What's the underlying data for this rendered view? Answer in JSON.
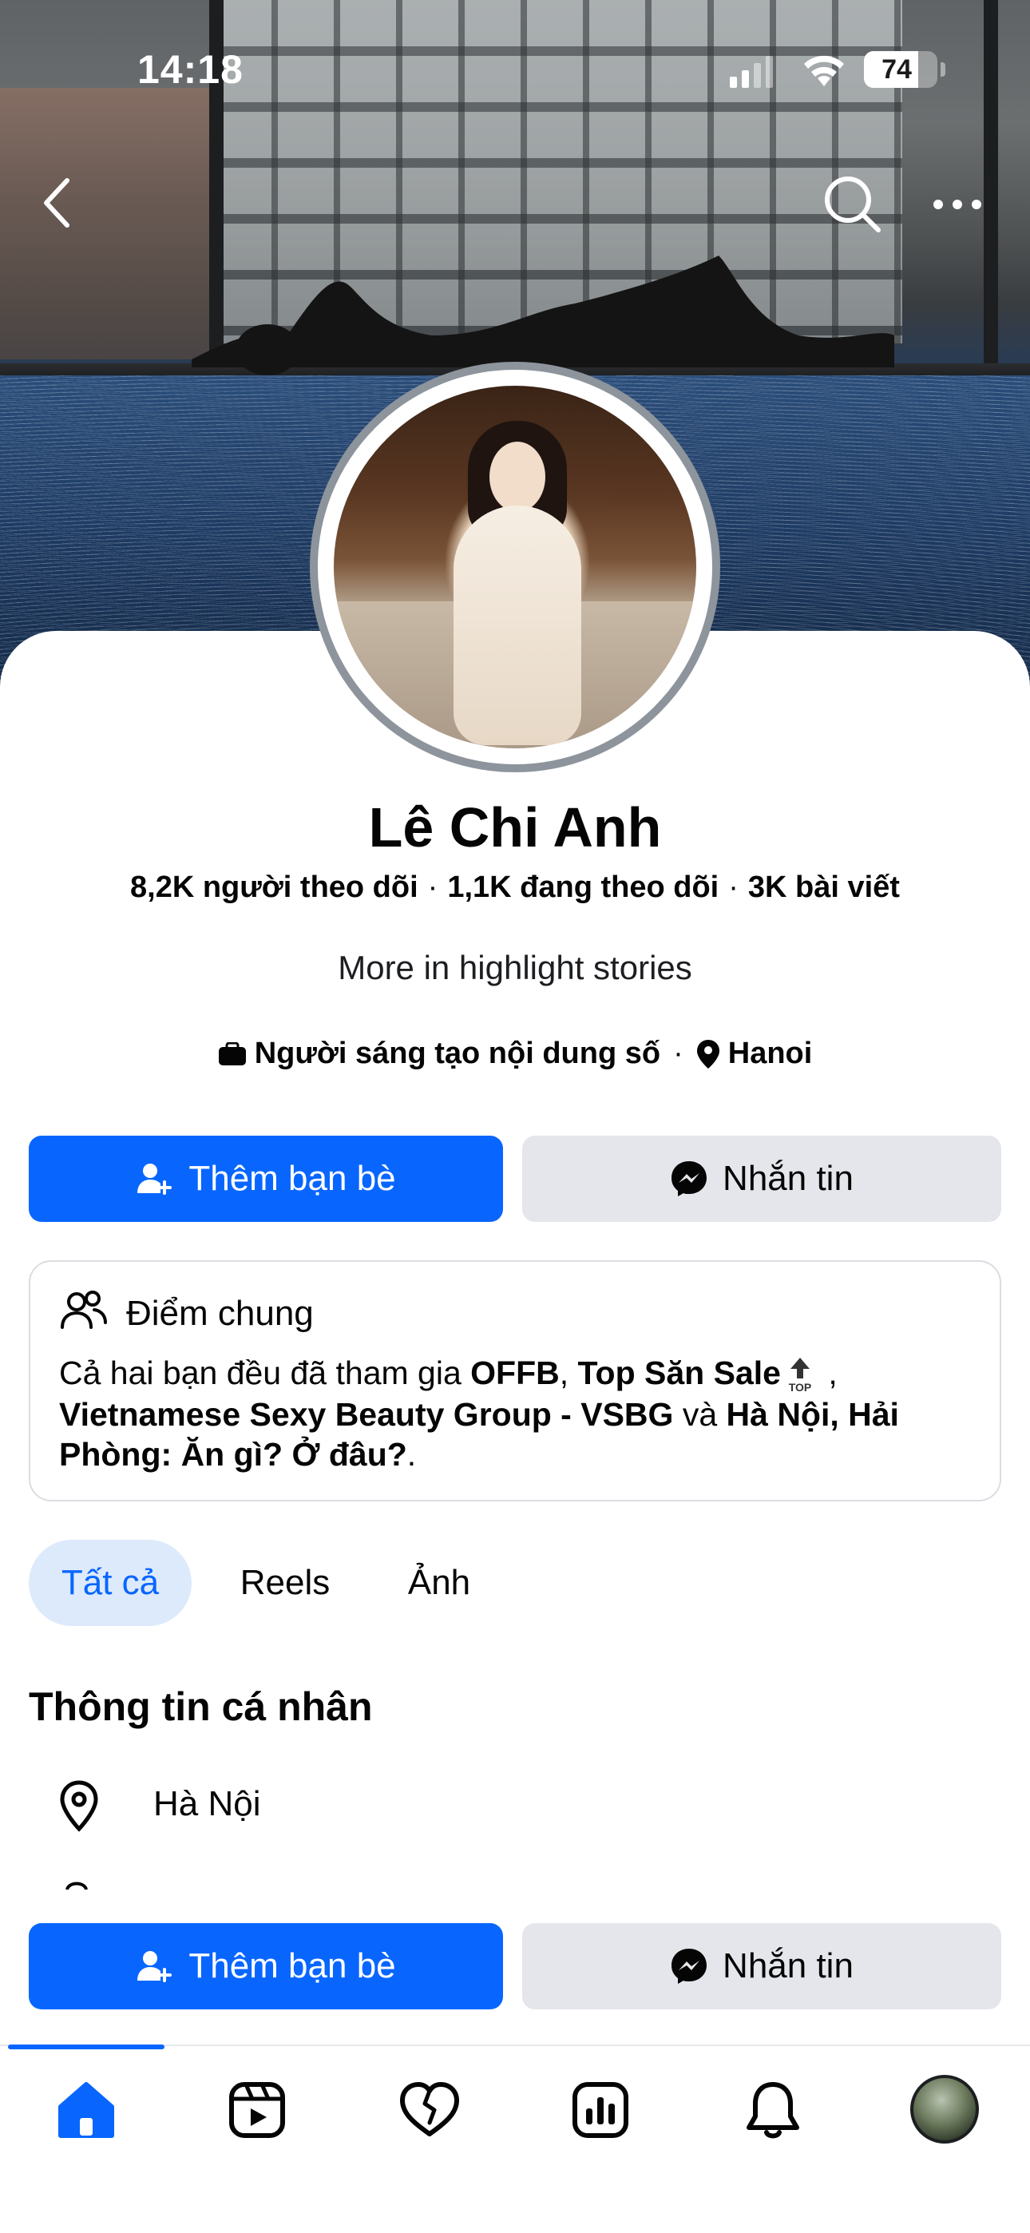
{
  "status_bar": {
    "time": "14:18",
    "battery": "74"
  },
  "top_nav": {
    "icons": [
      "back-chevron-icon",
      "search-icon",
      "more-icon"
    ]
  },
  "profile": {
    "name": "Lê Chi Anh",
    "followers": "8,2K người theo dõi",
    "following": "1,1K đang theo dõi",
    "posts": "3K bài viết",
    "separator": "·",
    "highlight_text": "More in highlight stories",
    "category": "Người sáng tạo nội dung số",
    "location": "Hanoi"
  },
  "actions": {
    "add_friend_label": "Thêm bạn bè",
    "message_label": "Nhắn tin"
  },
  "mutual": {
    "title": "Điểm chung",
    "prefix": "Cả hai bạn đều đã tham gia ",
    "group1": "OFFB",
    "comma1": ", ",
    "group2": "Top Săn Sale",
    "comma2": " ,",
    "group3": "Vietnamese Sexy Beauty Group - VSBG",
    "and_word": " và ",
    "group4": "Hà Nội, Hải Phòng: Ăn gì? Ở đâu?",
    "period": ".",
    "badge_text": "TOP"
  },
  "tabs": [
    {
      "label": "Tất cả",
      "active": true
    },
    {
      "label": "Reels",
      "active": false
    },
    {
      "label": "Ảnh",
      "active": false
    }
  ],
  "personal_info": {
    "title": "Thông tin cá nhân",
    "rows": [
      {
        "icon": "location-pin-icon",
        "text": "Hà Nội"
      }
    ]
  },
  "bottom_nav": {
    "items": [
      "home-icon",
      "reels-icon",
      "dating-heart-icon",
      "dashboard-icon",
      "notifications-bell-icon",
      "profile-avatar"
    ],
    "active": "home-icon"
  },
  "colors": {
    "accent": "#0866ff",
    "secondary_button": "#e4e6eb",
    "active_tab_bg": "#ddeafb"
  }
}
